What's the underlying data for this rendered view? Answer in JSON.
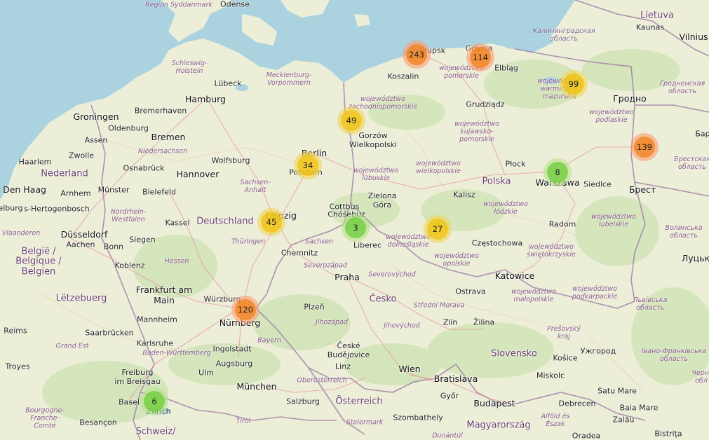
{
  "map": {
    "clusters": [
      {
        "count": "243",
        "size": "large"
      },
      {
        "count": "114",
        "size": "large"
      },
      {
        "count": "99",
        "size": "medium"
      },
      {
        "count": "49",
        "size": "medium"
      },
      {
        "count": "139",
        "size": "large"
      },
      {
        "count": "34",
        "size": "medium"
      },
      {
        "count": "8",
        "size": "small"
      },
      {
        "count": "45",
        "size": "medium"
      },
      {
        "count": "3",
        "size": "small"
      },
      {
        "count": "27",
        "size": "medium"
      },
      {
        "count": "120",
        "size": "large"
      },
      {
        "count": "6",
        "size": "small"
      }
    ],
    "countries": {
      "nederland": "Nederland",
      "belgie": "België /\nBelgique /\nBelgien",
      "letzebuerg": "Lëtzebuerg",
      "deutschland": "Deutschland",
      "polska": "Polska",
      "cesko": "Česko",
      "slovensko": "Slovensko",
      "osterreich": "Österreich",
      "magyarorszag": "Magyarország",
      "lietuva": "Lietuva",
      "schweiz": "Schweiz/"
    },
    "regions": {
      "syddanmark": "Region Syddanmark",
      "schleswig": "Schleswig-\nHolstein",
      "mecklenburg": "Mecklenburg-\nVorpommern",
      "niedersachsen": "Niedersachsen",
      "sachsen_anhalt": "Sachsen-\nAnhalt",
      "nordrhein": "Nordrhein-\nWestfalen",
      "thuringen": "Thüringen",
      "sachsen": "Sachsen",
      "hessen": "Hessen",
      "bayern": "Bayern",
      "bw": "Baden-Württemberg",
      "grand_est": "Grand Est",
      "bourgogne": "Bourgogne-\nFranche-\nComté",
      "vlaanderen": "Vlaanderen",
      "zachodnio": "województwo\nzachodniopomorskie",
      "pomorskie": "województwo\npomorskie",
      "warminsko": "województwo\nwarmińsko-\nmazurskie",
      "podlaskie": "województwo\npodlaskie",
      "kujawsko": "województwo\nkujawsko-\npomorskie",
      "lubuskie": "województwo\nlubuskie",
      "wielkopolskie": "województwo\nwielkopolskie",
      "lodzkie": "województwo\nłódzkie",
      "lubelskie": "województwo\nlubelskie",
      "dolnoslaskie": "województwo\ndolnośląskie",
      "opolskie": "województwo\nopolskie",
      "swietokrzyskie": "województwo\nświętokrzyskie",
      "malopolskie": "województwo\nmałopolskie",
      "podkarpackie": "województwo\npodkarpackie",
      "kaliningrad": "Калининградская\nобласть",
      "grodno_obl": "Гродненская\nобласть",
      "brest_obl": "Брестская\nобласть",
      "volyn": "Волинська\nобласть",
      "lviv": "Львівська\nобласть",
      "ivano": "Івано-Франківська\nобласть",
      "chernivtsi": "Черні\nобл",
      "severozapad": "Severozápad",
      "severovychod": "Severovýchod",
      "stredni_morava": "Střední Morava",
      "jihozapad": "Jihozápad",
      "jihovychod": "Jihovýchod",
      "presov": "Prešovský\nkraj",
      "oberosterreich": "Oberösterreich",
      "steiermark": "Steiermark",
      "tirol": "Tirol",
      "alfold": "Alföld és\nÉszak",
      "dunantul": "Dunántúl"
    },
    "cities": {
      "odense": "Odense",
      "lubeck": "Lübeck",
      "hamburg": "Hamburg",
      "groningen": "Groningen",
      "bremerhaven": "Bremerhaven",
      "oldenburg": "Oldenburg",
      "bremen": "Bremen",
      "assen": "Assen",
      "zwolle": "Zwolle",
      "haarlem": "Haarlem",
      "osnabruck": "Osnabrück",
      "hannover": "Hannover",
      "wolfsburg": "Wolfsburg",
      "berlin": "Berlin",
      "potsdam": "Potsdam",
      "den_haag": "Den Haag",
      "arnhem": "Arnhem",
      "munster": "Münster",
      "bielefeld": "Bielefeld",
      "hertogenbosch": "s-Hertogenbosch",
      "elburg": "elburg",
      "dusseldorf": "Düsseldorf",
      "kassel": "Kassel",
      "leipzig": "Leipzig",
      "aachen": "Aachen",
      "bonn": "Bonn",
      "siegen": "Siegen",
      "chemnitz": "Chemnitz",
      "koblenz": "Koblenz",
      "frankfurt": "Frankfurt am\nMain",
      "wurzburg": "Würzburg",
      "nurnberg": "Nürnberg",
      "mannheim": "Mannheim",
      "saarbrucken": "Saarbrücken",
      "karlsruhe": "Karlsruhe",
      "ingolstadt": "Ingolstadt",
      "reims": "Reims",
      "augsburg": "Augsburg",
      "ulm": "Ulm",
      "troyes": "Troyes",
      "freiburg": "Freiburg\nim Breisgau",
      "munchen": "München",
      "basel": "Basel",
      "zurich": "Zürich",
      "besancon": "Besançon",
      "salzburg": "Salzburg",
      "slupsk": "Słupsk",
      "gdynia": "Gdynia",
      "koszalin": "Koszalin",
      "elblag": "Elbląg",
      "grudziadz": "Grudziądz",
      "gorzow": "Gorzów\nWielkopolski",
      "cottbus": "Cottbus",
      "chosebuz": "Chóśebuz",
      "zielona": "Zielona\nGóra",
      "plock": "Płock",
      "warszawa": "Warszawa",
      "siedlce": "Siedlce",
      "kalisz": "Kalisz",
      "liberec": "Liberec",
      "czestochowa": "Częstochowa",
      "radom": "Radom",
      "praha": "Praha",
      "plzen": "Plzeň",
      "katowice": "Katowice",
      "ostrava": "Ostrava",
      "zlin": "Zlín",
      "zilina": "Žilina",
      "ceske": "České\nBudějovice",
      "linz": "Linz",
      "wien": "Wien",
      "bratislava": "Bratislava",
      "gyor": "Győr",
      "budapest": "Budapest",
      "szombathely": "Szombathely",
      "kosice": "Košice",
      "uzhhorod": "Ужгород",
      "miskolc": "Miskolc",
      "debrecen": "Debrecen",
      "satu_mare": "Satu Mare",
      "baia_mare": "Baia Mare",
      "zalau": "Zalău",
      "oradea": "Oradea",
      "bistrita": "Bistriţa",
      "kaunas": "Kaunas",
      "vilnius": "Vilnius",
      "grodno": "Гродно",
      "brest": "Брест",
      "lutsk": "Луцьк",
      "bar": "Бар"
    }
  }
}
